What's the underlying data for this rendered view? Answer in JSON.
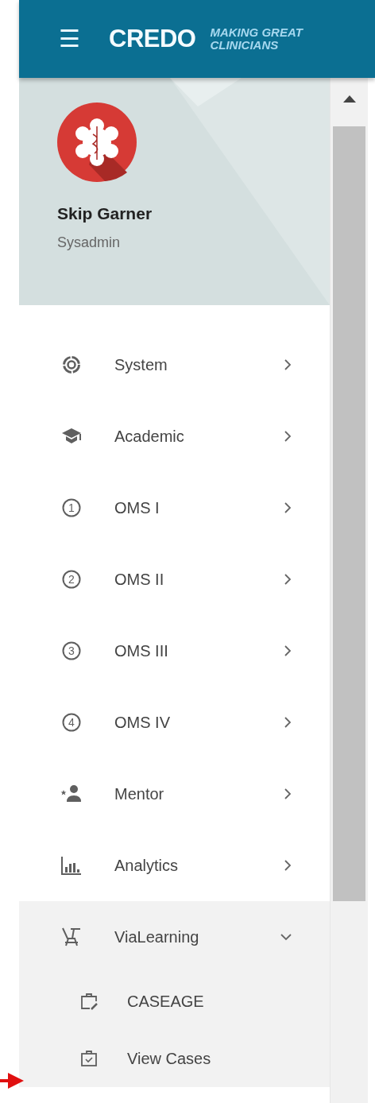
{
  "header": {
    "menu_icon": "☰",
    "logo": "CREDO",
    "tagline": [
      "MAKING GREAT",
      "CLINICIANS"
    ]
  },
  "profile": {
    "name": "Skip Garner",
    "role": "Sysadmin"
  },
  "menu": [
    {
      "label": "System",
      "expanded": false
    },
    {
      "label": "Academic",
      "expanded": false
    },
    {
      "label": "OMS I",
      "number": "1",
      "expanded": false
    },
    {
      "label": "OMS II",
      "number": "2",
      "expanded": false
    },
    {
      "label": "OMS III",
      "number": "3",
      "expanded": false
    },
    {
      "label": "OMS IV",
      "number": "4",
      "expanded": false
    },
    {
      "label": "Mentor",
      "expanded": false
    },
    {
      "label": "Analytics",
      "expanded": false
    },
    {
      "label": "ViaLearning",
      "expanded": true,
      "children": [
        {
          "label": "CASEAGE"
        },
        {
          "label": "View Cases"
        }
      ]
    }
  ]
}
